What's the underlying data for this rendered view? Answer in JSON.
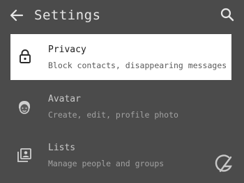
{
  "app_bar": {
    "title": "Settings",
    "back_icon": "arrow-left-icon",
    "search_icon": "search-icon"
  },
  "settings": {
    "items": [
      {
        "title": "Privacy",
        "subtitle": "Block contacts, disappearing messages",
        "icon": "lock-icon",
        "highlighted": true
      },
      {
        "title": "Avatar",
        "subtitle": "Create, edit, profile photo",
        "icon": "avatar-face-icon",
        "highlighted": false
      },
      {
        "title": "Lists",
        "subtitle": "Manage people and groups",
        "icon": "contact-list-icon",
        "highlighted": false
      }
    ]
  },
  "watermark": {
    "icon": "watermark-logo-icon"
  },
  "colors": {
    "dimmed_background": "#4b4b4b",
    "highlight_background": "#ffffff"
  }
}
